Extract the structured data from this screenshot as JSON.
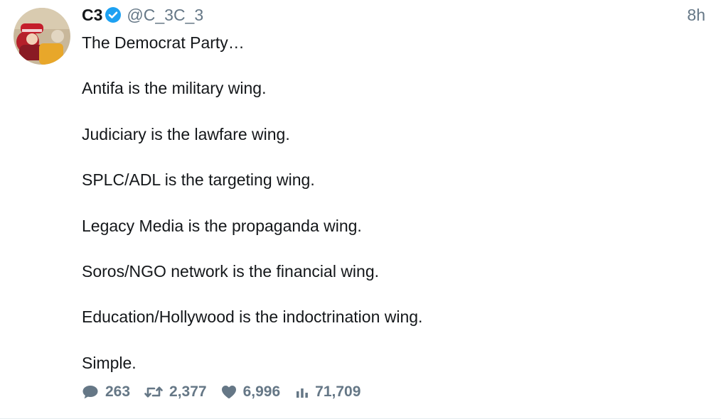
{
  "tweet": {
    "author": {
      "display_name": "C3",
      "handle": "@C_3C_3",
      "verified_icon": "verified-badge-icon",
      "avatar": "profile-avatar"
    },
    "timestamp": "8h",
    "text_lines": [
      "The Democrat Party…",
      "Antifa is the military wing.",
      "Judiciary is the lawfare wing.",
      "SPLC/ADL is the targeting wing.",
      "Legacy Media is the propaganda wing.",
      "Soros/NGO network is the financial wing.",
      "Education/Hollywood is the indoctrination wing.",
      "Simple."
    ],
    "actions": {
      "replies": {
        "icon": "reply-bubble-icon",
        "count": "263"
      },
      "retweets": {
        "icon": "retweet-icon",
        "count": "2,377"
      },
      "likes": {
        "icon": "heart-icon",
        "count": "6,996"
      },
      "views": {
        "icon": "views-bar-chart-icon",
        "count": "71,709"
      }
    }
  },
  "colors": {
    "text": "#14171a",
    "secondary_text": "#657786",
    "verified_blue": "#1da1f2",
    "divider": "#e6ecf0"
  }
}
